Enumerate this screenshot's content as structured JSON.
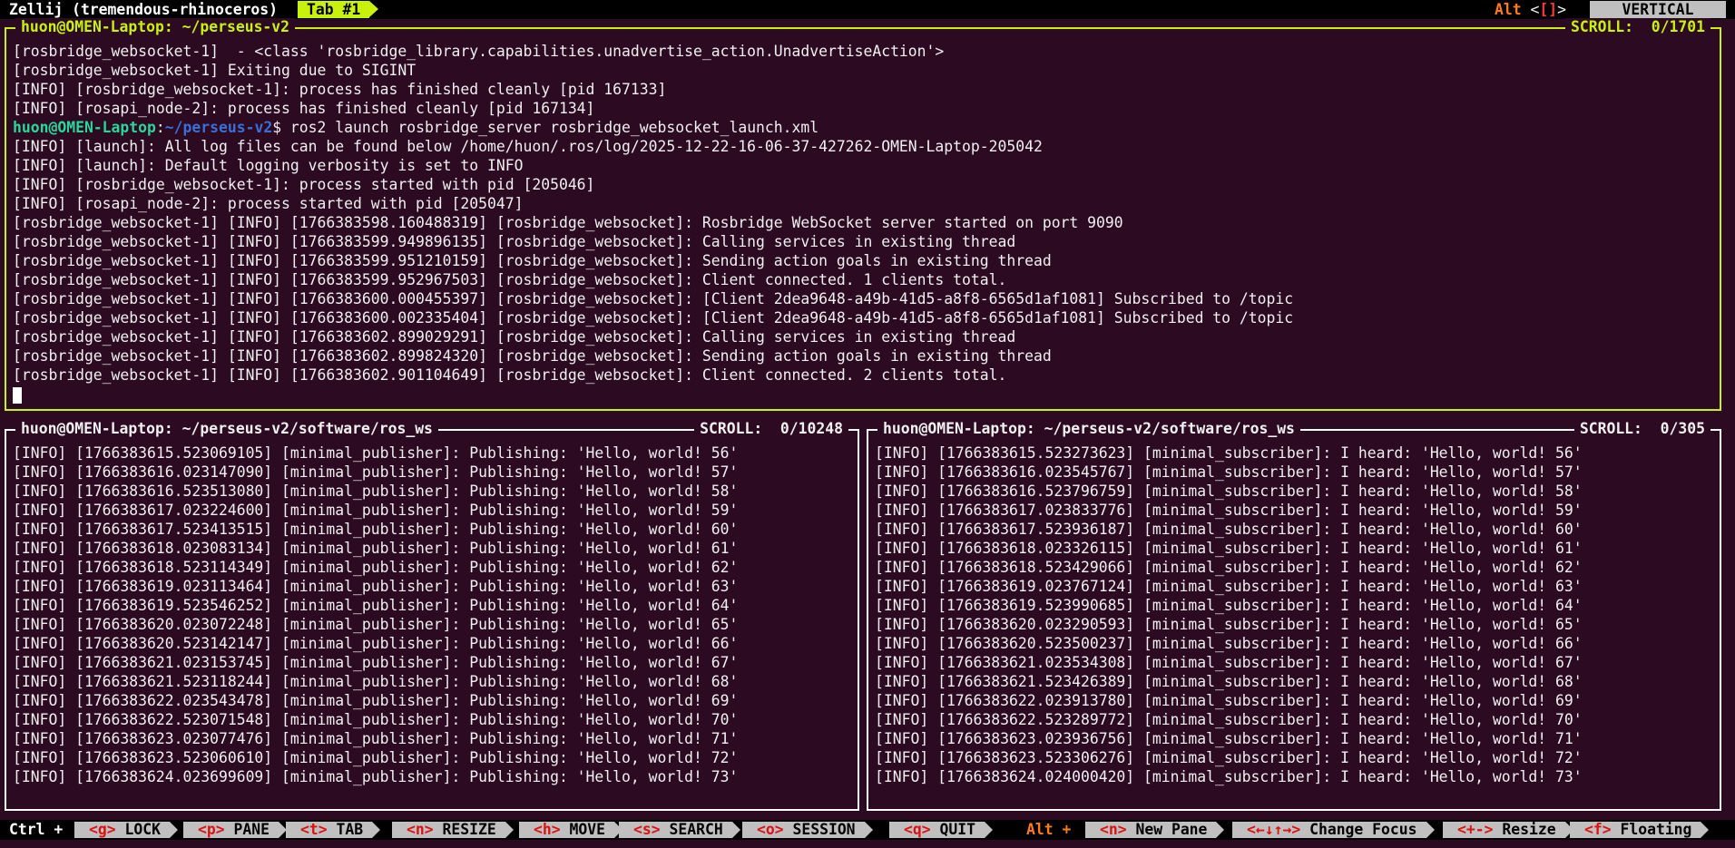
{
  "topbar": {
    "session": "Zellij (tremendous-rhinoceros)",
    "tab": "Tab #1",
    "alt_key": "Alt",
    "alt_lt": " <",
    "alt_brackets": "[]",
    "alt_gt": ">",
    "mode": "VERTICAL"
  },
  "panes": {
    "top": {
      "title": "huon@OMEN-Laptop: ~/perseus-v2",
      "scroll": "SCROLL:  0/1701",
      "lines_before": [
        "[rosbridge_websocket-1]  - <class 'rosbridge_library.capabilities.unadvertise_action.UnadvertiseAction'>",
        "[rosbridge_websocket-1] Exiting due to SIGINT",
        "[INFO] [rosbridge_websocket-1]: process has finished cleanly [pid 167133]",
        "[INFO] [rosapi_node-2]: process has finished cleanly [pid 167134]"
      ],
      "prompt_user": "huon@OMEN-Laptop",
      "prompt_colon": ":",
      "prompt_path": "~/perseus-v2",
      "prompt_cmd": "$ ros2 launch rosbridge_server rosbridge_websocket_launch.xml",
      "lines_after": [
        "[INFO] [launch]: All log files can be found below /home/huon/.ros/log/2025-12-22-16-06-37-427262-OMEN-Laptop-205042",
        "[INFO] [launch]: Default logging verbosity is set to INFO",
        "[INFO] [rosbridge_websocket-1]: process started with pid [205046]",
        "[INFO] [rosapi_node-2]: process started with pid [205047]",
        "[rosbridge_websocket-1] [INFO] [1766383598.160488319] [rosbridge_websocket]: Rosbridge WebSocket server started on port 9090",
        "[rosbridge_websocket-1] [INFO] [1766383599.949896135] [rosbridge_websocket]: Calling services in existing thread",
        "[rosbridge_websocket-1] [INFO] [1766383599.951210159] [rosbridge_websocket]: Sending action goals in existing thread",
        "[rosbridge_websocket-1] [INFO] [1766383599.952967503] [rosbridge_websocket]: Client connected. 1 clients total.",
        "[rosbridge_websocket-1] [INFO] [1766383600.000455397] [rosbridge_websocket]: [Client 2dea9648-a49b-41d5-a8f8-6565d1af1081] Subscribed to /topic",
        "[rosbridge_websocket-1] [INFO] [1766383600.002335404] [rosbridge_websocket]: [Client 2dea9648-a49b-41d5-a8f8-6565d1af1081] Subscribed to /topic",
        "[rosbridge_websocket-1] [INFO] [1766383602.899029291] [rosbridge_websocket]: Calling services in existing thread",
        "[rosbridge_websocket-1] [INFO] [1766383602.899824320] [rosbridge_websocket]: Sending action goals in existing thread",
        "[rosbridge_websocket-1] [INFO] [1766383602.901104649] [rosbridge_websocket]: Client connected. 2 clients total."
      ]
    },
    "left": {
      "title": "huon@OMEN-Laptop: ~/perseus-v2/software/ros_ws",
      "scroll": "SCROLL:  0/10248",
      "lines": [
        "[INFO] [1766383615.523069105] [minimal_publisher]: Publishing: 'Hello, world! 56'",
        "[INFO] [1766383616.023147090] [minimal_publisher]: Publishing: 'Hello, world! 57'",
        "[INFO] [1766383616.523513080] [minimal_publisher]: Publishing: 'Hello, world! 58'",
        "[INFO] [1766383617.023224600] [minimal_publisher]: Publishing: 'Hello, world! 59'",
        "[INFO] [1766383617.523413515] [minimal_publisher]: Publishing: 'Hello, world! 60'",
        "[INFO] [1766383618.023083134] [minimal_publisher]: Publishing: 'Hello, world! 61'",
        "[INFO] [1766383618.523114349] [minimal_publisher]: Publishing: 'Hello, world! 62'",
        "[INFO] [1766383619.023113464] [minimal_publisher]: Publishing: 'Hello, world! 63'",
        "[INFO] [1766383619.523546252] [minimal_publisher]: Publishing: 'Hello, world! 64'",
        "[INFO] [1766383620.023072248] [minimal_publisher]: Publishing: 'Hello, world! 65'",
        "[INFO] [1766383620.523142147] [minimal_publisher]: Publishing: 'Hello, world! 66'",
        "[INFO] [1766383621.023153745] [minimal_publisher]: Publishing: 'Hello, world! 67'",
        "[INFO] [1766383621.523118244] [minimal_publisher]: Publishing: 'Hello, world! 68'",
        "[INFO] [1766383622.023543478] [minimal_publisher]: Publishing: 'Hello, world! 69'",
        "[INFO] [1766383622.523071548] [minimal_publisher]: Publishing: 'Hello, world! 70'",
        "[INFO] [1766383623.023077476] [minimal_publisher]: Publishing: 'Hello, world! 71'",
        "[INFO] [1766383623.523060610] [minimal_publisher]: Publishing: 'Hello, world! 72'",
        "[INFO] [1766383624.023699609] [minimal_publisher]: Publishing: 'Hello, world! 73'"
      ]
    },
    "right": {
      "title": "huon@OMEN-Laptop: ~/perseus-v2/software/ros_ws",
      "scroll": "SCROLL:  0/305",
      "lines": [
        "[INFO] [1766383615.523273623] [minimal_subscriber]: I heard: 'Hello, world! 56'",
        "[INFO] [1766383616.023545767] [minimal_subscriber]: I heard: 'Hello, world! 57'",
        "[INFO] [1766383616.523796759] [minimal_subscriber]: I heard: 'Hello, world! 58'",
        "[INFO] [1766383617.023833776] [minimal_subscriber]: I heard: 'Hello, world! 59'",
        "[INFO] [1766383617.523936187] [minimal_subscriber]: I heard: 'Hello, world! 60'",
        "[INFO] [1766383618.023326115] [minimal_subscriber]: I heard: 'Hello, world! 61'",
        "[INFO] [1766383618.523429066] [minimal_subscriber]: I heard: 'Hello, world! 62'",
        "[INFO] [1766383619.023767124] [minimal_subscriber]: I heard: 'Hello, world! 63'",
        "[INFO] [1766383619.523990685] [minimal_subscriber]: I heard: 'Hello, world! 64'",
        "[INFO] [1766383620.023290593] [minimal_subscriber]: I heard: 'Hello, world! 65'",
        "[INFO] [1766383620.523500237] [minimal_subscriber]: I heard: 'Hello, world! 66'",
        "[INFO] [1766383621.023534308] [minimal_subscriber]: I heard: 'Hello, world! 67'",
        "[INFO] [1766383621.523426389] [minimal_subscriber]: I heard: 'Hello, world! 68'",
        "[INFO] [1766383622.023913780] [minimal_subscriber]: I heard: 'Hello, world! 69'",
        "[INFO] [1766383622.523289772] [minimal_subscriber]: I heard: 'Hello, world! 70'",
        "[INFO] [1766383623.023936756] [minimal_subscriber]: I heard: 'Hello, world! 71'",
        "[INFO] [1766383623.523306276] [minimal_subscriber]: I heard: 'Hello, world! 72'",
        "[INFO] [1766383624.024000420] [minimal_subscriber]: I heard: 'Hello, world! 73'"
      ]
    }
  },
  "bottombar": {
    "ctrl_label": "Ctrl +",
    "ctrl_items": [
      {
        "key": "<g>",
        "label": " LOCK"
      },
      {
        "key": "<p>",
        "label": " PANE"
      },
      {
        "key": "<t>",
        "label": " TAB"
      },
      {
        "key": "<n>",
        "label": " RESIZE"
      },
      {
        "key": "<h>",
        "label": " MOVE"
      },
      {
        "key": "<s>",
        "label": " SEARCH"
      },
      {
        "key": "<o>",
        "label": " SESSION"
      },
      {
        "key": "<q>",
        "label": " QUIT"
      }
    ],
    "alt_label": "Alt +",
    "alt_items": [
      {
        "key": "<n>",
        "label": " New Pane"
      },
      {
        "key": "<←↓↑→>",
        "label": " Change Focus"
      },
      {
        "key": "<+->",
        "label": " Resize"
      },
      {
        "key": "<f>",
        "label": " Floating"
      }
    ]
  },
  "colors": {
    "background": "#2c0a22",
    "accent": "#c8f20c",
    "chip": "#c0c0c0",
    "key": "#d11111",
    "alt": "#ff7a1a",
    "prompt_user": "#2ad69a",
    "prompt_path": "#3b6fd8"
  }
}
